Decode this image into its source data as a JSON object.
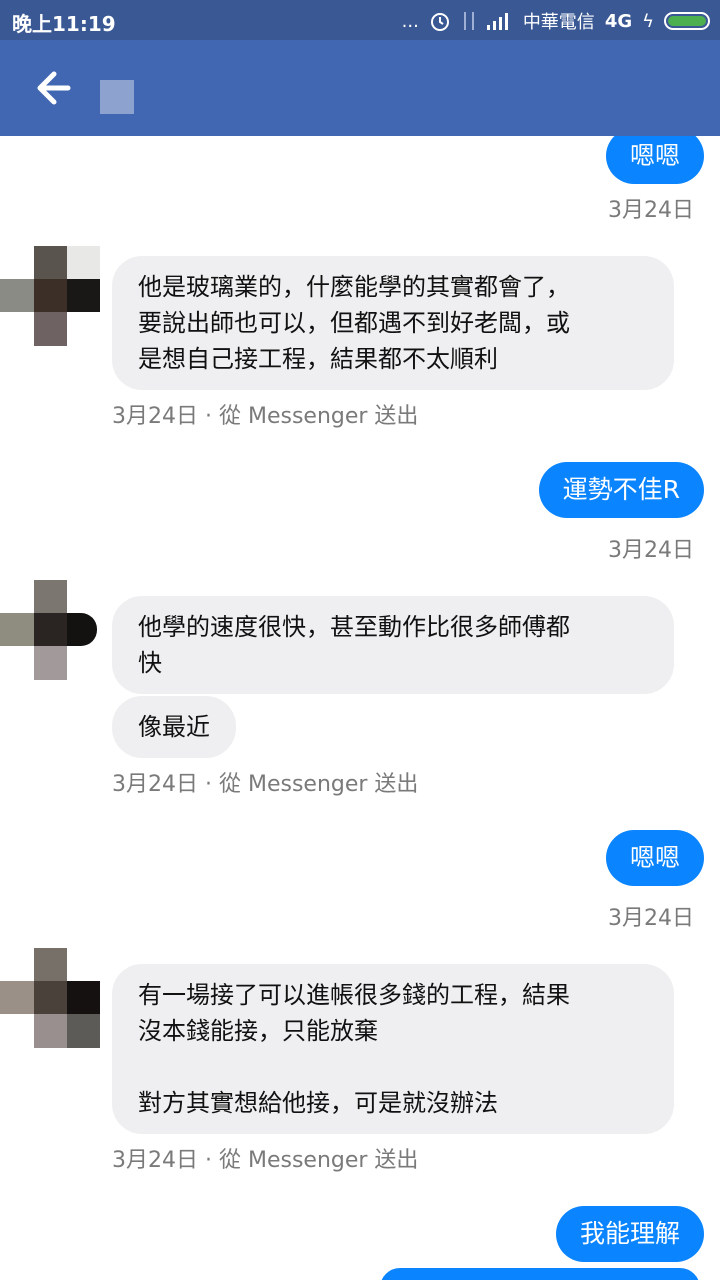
{
  "status_bar": {
    "time": "晚上11:19",
    "dots": "...",
    "carrier": "中華電信",
    "network": "4G",
    "charging": "ϟ"
  },
  "header": {
    "back_icon": "arrow-left-icon"
  },
  "messages": {
    "out1": {
      "text": "嗯嗯",
      "ts": "3月24日"
    },
    "in1": {
      "lines": [
        "他是玻璃業的，什麼能學的其實都會了，",
        "要說出師也可以，但都遇不到好老闆，或",
        "是想自己接工程，結果都不太順利"
      ],
      "ts": "3月24日 · 從 Messenger 送出"
    },
    "out2": {
      "text": "運勢不佳R",
      "ts": "3月24日"
    },
    "in2": {
      "lines": [
        "他學的速度很快，甚至動作比很多師傅都",
        "快"
      ],
      "extra": "像最近",
      "ts": "3月24日 · 從 Messenger 送出"
    },
    "out3": {
      "text": "嗯嗯",
      "ts": "3月24日"
    },
    "in3": {
      "lines": [
        "有一場接了可以進帳很多錢的工程，結果",
        "沒本錢能接，只能放棄",
        "",
        " 對方其實想給他接，可是就沒辦法"
      ],
      "ts": "3月24日 · 從 Messenger 送出"
    },
    "out4": {
      "text": "我能理解"
    }
  },
  "colors": {
    "status_bar": "#3a5894",
    "header": "#4267b2",
    "outgoing_bubble": "#0a84ff",
    "incoming_bubble": "#efeff1"
  }
}
